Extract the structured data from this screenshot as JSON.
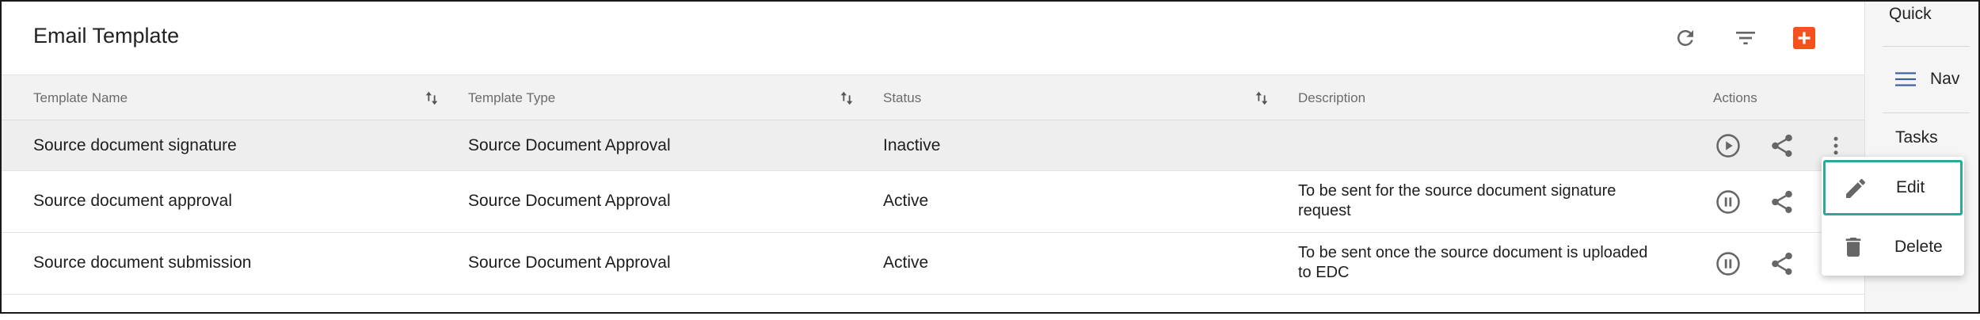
{
  "page": {
    "title": "Email Template"
  },
  "header_actions": {
    "refresh_icon": "refresh-icon",
    "filter_icon": "filter-icon",
    "add_icon": "add-icon",
    "add_color": "#f4511e"
  },
  "table": {
    "columns": [
      {
        "label": "Template Name",
        "sortable": true
      },
      {
        "label": "Template Type",
        "sortable": true
      },
      {
        "label": "Status",
        "sortable": true
      },
      {
        "label": "Description",
        "sortable": false
      },
      {
        "label": "Actions",
        "sortable": false
      }
    ],
    "rows": [
      {
        "name": "Source document signature",
        "type": "Source Document Approval",
        "status": "Inactive",
        "description_line1": "",
        "description_line2": "",
        "state_icon": "play-icon",
        "selected": true
      },
      {
        "name": "Source document approval",
        "type": "Source Document Approval",
        "status": "Active",
        "description_line1": "To be sent for the source document signature",
        "description_line2": "request",
        "state_icon": "pause-icon",
        "selected": false
      },
      {
        "name": "Source document submission",
        "type": "Source Document Approval",
        "status": "Active",
        "description_line1": "To be sent once the source document is uploaded",
        "description_line2": "to EDC",
        "state_icon": "pause-icon",
        "selected": false
      }
    ]
  },
  "side_panel": {
    "items": [
      {
        "label": "Quick"
      },
      {
        "label": "Nav",
        "icon": "menu-icon"
      },
      {
        "label": "Tasks"
      }
    ]
  },
  "context_menu": {
    "items": [
      {
        "label": "Edit",
        "icon": "pencil-icon",
        "focused": true,
        "focus_color": "#2aa89a"
      },
      {
        "label": "Delete",
        "icon": "trash-icon",
        "focused": false
      }
    ]
  }
}
